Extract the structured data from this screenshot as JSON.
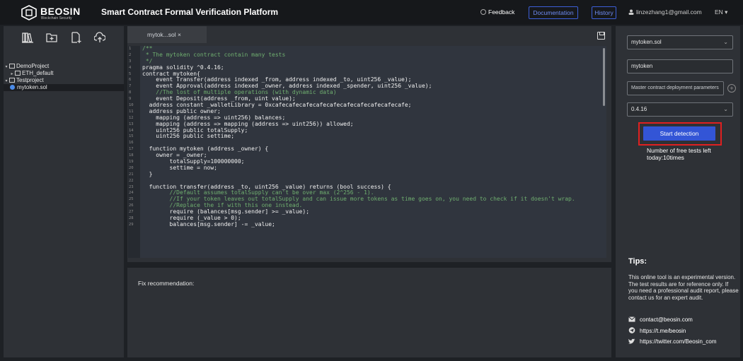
{
  "header": {
    "brand": "BEOSIN",
    "brand_sub": "Blockchain Security",
    "title": "Smart Contract Formal Verification Platform",
    "feedback": "Feedback",
    "documentation": "Documentation",
    "history": "History",
    "user_email": "linzezhang1@gmail.com",
    "language": "EN"
  },
  "sidebar": {
    "toolbar_icons": [
      "library-icon",
      "new-folder-icon",
      "new-file-icon",
      "upload-icon"
    ],
    "tree": [
      {
        "label": "DemoProject",
        "level": 0,
        "expanded": true,
        "type": "project"
      },
      {
        "label": "ETH_default",
        "level": 1,
        "expanded": false,
        "type": "folder"
      },
      {
        "label": "Testproject",
        "level": 0,
        "expanded": true,
        "type": "project"
      },
      {
        "label": "mytoken.sol",
        "level": 1,
        "type": "file",
        "selected": true
      }
    ]
  },
  "editor": {
    "tab_label": "mytok...sol ×",
    "lines": [
      {
        "n": "1",
        "t": "/**",
        "k": "cm"
      },
      {
        "n": "2",
        "t": " * The mytoken contract contain many tests",
        "k": "cm"
      },
      {
        "n": "3",
        "t": " */",
        "k": "cm"
      },
      {
        "n": "4",
        "t": "pragma solidity ^0.4.16;",
        "k": ""
      },
      {
        "n": "5",
        "t": "contract mytoken{",
        "k": ""
      },
      {
        "n": "6",
        "t": "    event Transfer(address indexed _from, address indexed _to, uint256 _value);",
        "k": ""
      },
      {
        "n": "7",
        "t": "    event Approval(address indexed _owner, address indexed _spender, uint256 _value);",
        "k": ""
      },
      {
        "n": "8",
        "t": "    //The lost of multiple operations (with dynamic data)",
        "k": "cm"
      },
      {
        "n": "9",
        "t": "    event Deposit(address _from, uint value);",
        "k": ""
      },
      {
        "n": "10",
        "t": "  address constant _walletLibrary = 0xcafecafecafecafecafecafecafecafecafecafe;",
        "k": ""
      },
      {
        "n": "11",
        "t": "  address public owner;",
        "k": ""
      },
      {
        "n": "12",
        "t": "    mapping (address => uint256) balances;",
        "k": ""
      },
      {
        "n": "13",
        "t": "    mapping (address => mapping (address => uint256)) allowed;",
        "k": ""
      },
      {
        "n": "14",
        "t": "    uint256 public totalSupply;",
        "k": ""
      },
      {
        "n": "15",
        "t": "    uint256 public settime;",
        "k": ""
      },
      {
        "n": "16",
        "t": "",
        "k": ""
      },
      {
        "n": "17",
        "t": "  function mytoken (address _owner) {",
        "k": ""
      },
      {
        "n": "18",
        "t": "    owner = _owner;",
        "k": ""
      },
      {
        "n": "19",
        "t": "        totalSupply=100000000;",
        "k": ""
      },
      {
        "n": "20",
        "t": "        settime = now;",
        "k": ""
      },
      {
        "n": "21",
        "t": "  }",
        "k": ""
      },
      {
        "n": "22",
        "t": "",
        "k": ""
      },
      {
        "n": "23",
        "t": "  function transfer(address _to, uint256 _value) returns (bool success) {",
        "k": ""
      },
      {
        "n": "24",
        "t": "        //Default assumes totalSupply can't be over max (2^256 - 1).",
        "k": "cm"
      },
      {
        "n": "25",
        "t": "        //If your token leaves out totalSupply and can issue more tokens as time goes on, you need to check if it doesn't wrap.",
        "k": "cm"
      },
      {
        "n": "26",
        "t": "        //Replace the if with this one instead.",
        "k": "cm"
      },
      {
        "n": "27",
        "t": "        require (balances[msg.sender] >= _value);",
        "k": ""
      },
      {
        "n": "28",
        "t": "        require (_value > 0);",
        "k": ""
      },
      {
        "n": "29",
        "t": "        balances[msg.sender] -= _value;",
        "k": ""
      }
    ]
  },
  "fix": {
    "label": "Fix recommendation:"
  },
  "right": {
    "file_select": "mytoken.sol",
    "contract_name": "mytoken",
    "deploy_params_placeholder": "Master contract deployment parameters",
    "compiler_version": "0.4.16",
    "start_detection": "Start detection",
    "free_tests": "Number of free tests left today:10times",
    "tips_title": "Tips:",
    "tips_text": "This online tool is an experimental version. The test results are for reference only. If you need a professional audit report, please contact us for an expert audit.",
    "contacts": [
      {
        "icon": "email-icon",
        "text": "contact@beosin.com"
      },
      {
        "icon": "telegram-icon",
        "text": "https://t.me/beosin"
      },
      {
        "icon": "twitter-icon",
        "text": "https://twitter.com/Beosin_com"
      }
    ]
  },
  "colors": {
    "primary_button": "#3355d6",
    "highlight_border": "#e02020",
    "link_outline": "#3d5fd8"
  }
}
